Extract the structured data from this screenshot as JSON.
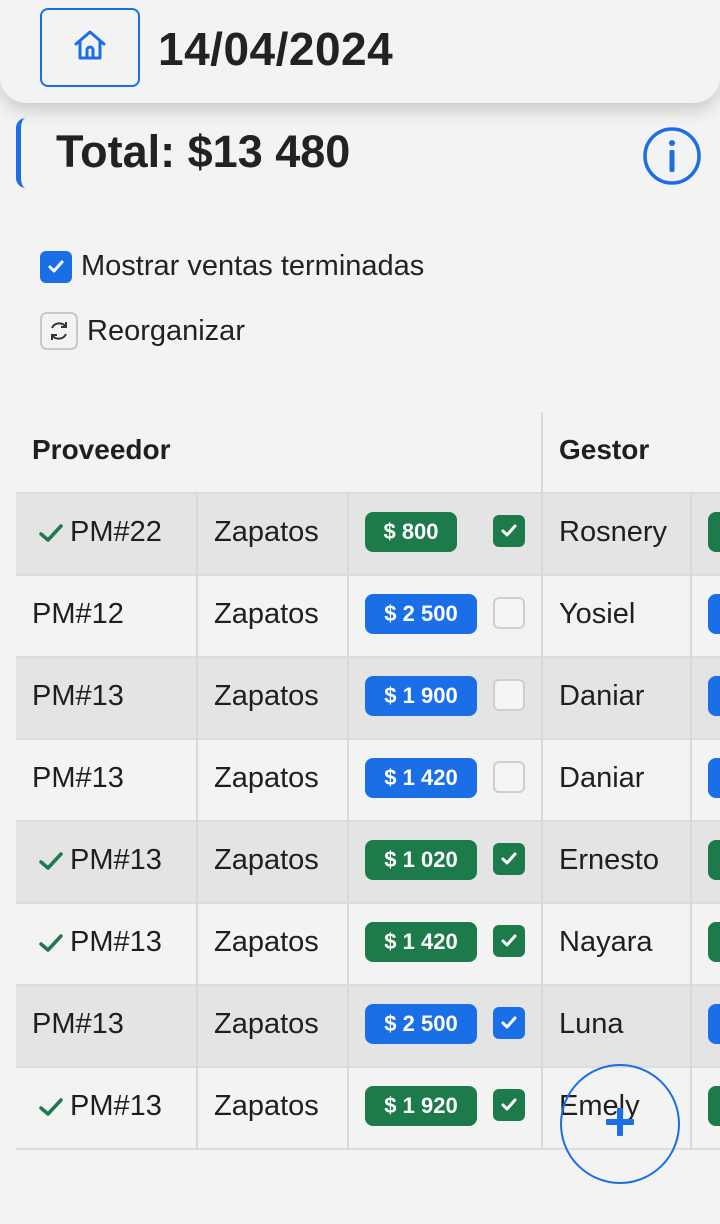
{
  "header": {
    "date": "14/04/2024"
  },
  "summary": {
    "total": "Total: $13 480"
  },
  "options": {
    "show_finished": "Mostrar ventas terminadas",
    "reorganize": "Reorganizar"
  },
  "table": {
    "columns": [
      "Proveedor",
      "Gestor"
    ],
    "rows": [
      {
        "proveedor": "PM#22",
        "producto": "Zapatos",
        "monto": "$ 800",
        "done": true,
        "checked": true,
        "gestor": "Rosnery"
      },
      {
        "proveedor": "PM#12",
        "producto": "Zapatos",
        "monto": "$ 2 500",
        "done": false,
        "checked": false,
        "gestor": "Yosiel"
      },
      {
        "proveedor": "PM#13",
        "producto": "Zapatos",
        "monto": "$ 1 900",
        "done": false,
        "checked": false,
        "gestor": "Daniar"
      },
      {
        "proveedor": "PM#13",
        "producto": "Zapatos",
        "monto": "$ 1 420",
        "done": false,
        "checked": false,
        "gestor": "Daniar"
      },
      {
        "proveedor": "PM#13",
        "producto": "Zapatos",
        "monto": "$ 1 020",
        "done": true,
        "checked": true,
        "gestor": "Ernesto"
      },
      {
        "proveedor": "PM#13",
        "producto": "Zapatos",
        "monto": "$ 1 420",
        "done": true,
        "checked": true,
        "gestor": "Nayara"
      },
      {
        "proveedor": "PM#13",
        "producto": "Zapatos",
        "monto": "$ 2 500",
        "done": false,
        "checked": true,
        "gestor": "Luna"
      },
      {
        "proveedor": "PM#13",
        "producto": "Zapatos",
        "monto": "$ 1 920",
        "done": true,
        "checked": true,
        "gestor": "Emely"
      }
    ]
  },
  "colors": {
    "accent": "#1a6fe6",
    "success": "#1d7a4b",
    "background": "#f3f3f3",
    "stripe": "#e4e4e4"
  },
  "icons": {
    "home": "home-icon",
    "info": "info-icon",
    "reorganize": "refresh-icon",
    "add": "plus-icon",
    "done": "check-icon"
  }
}
